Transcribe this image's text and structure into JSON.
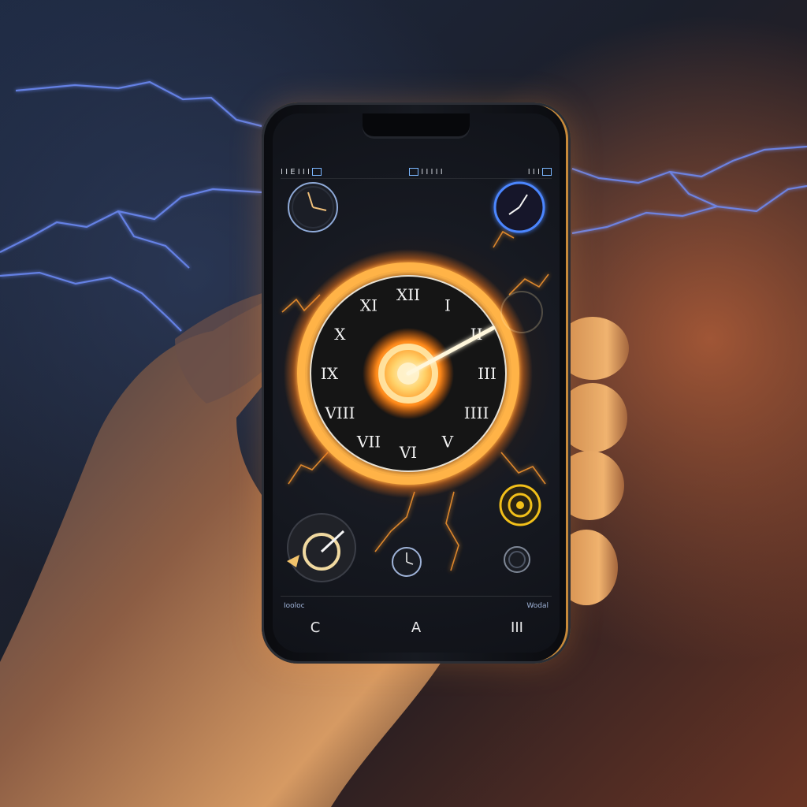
{
  "phone": {
    "status_bar": {
      "left_text": "I I E I I I",
      "center_text": "I I I I I",
      "right_text": "I I I"
    },
    "bottom_labels": {
      "left": "Iooloc",
      "right": "Wodal"
    },
    "nav": {
      "back_glyph": "C",
      "home_glyph": "A",
      "recents_glyph": "III"
    },
    "main_clock_numerals": [
      "XII",
      "I",
      "II",
      "III",
      "IIII",
      "V",
      "VI",
      "VII",
      "VIII",
      "IX",
      "X",
      "XI"
    ]
  },
  "colors": {
    "lightning": "#6f8fff",
    "glow": "#ffb347",
    "fire": "#ff7a1a",
    "clock_face": "#151515",
    "numerals": "#f2f2f2"
  }
}
